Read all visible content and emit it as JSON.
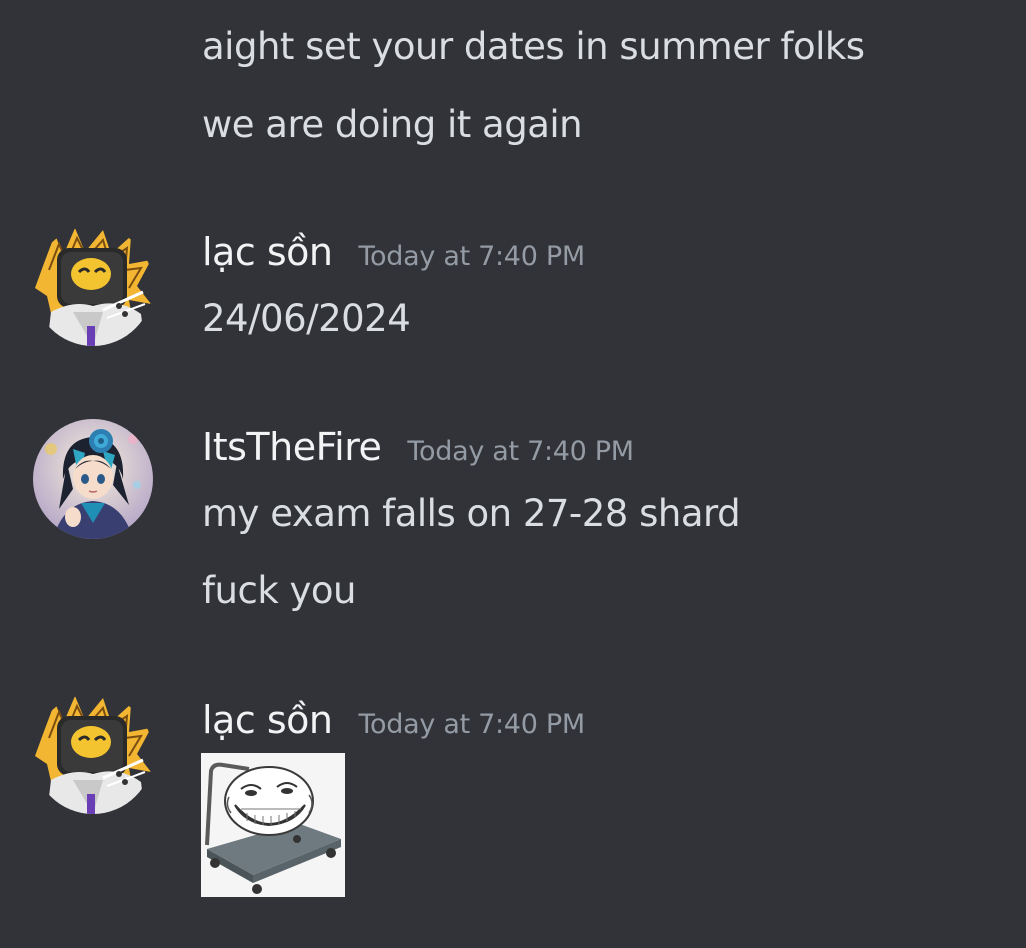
{
  "messages": {
    "continued": {
      "lines": [
        "aight set your dates in summer folks",
        "we are doing it again"
      ]
    },
    "msg1": {
      "username": "lạc sồn",
      "timestamp": "Today at 7:40 PM",
      "lines": [
        "24/06/2024"
      ],
      "avatar_icon": "robot-avatar"
    },
    "msg2": {
      "username": "ItsTheFire",
      "timestamp": "Today at 7:40 PM",
      "lines": [
        "my exam falls on 27-28 shard",
        "fuck you"
      ],
      "avatar_icon": "anime-character-avatar"
    },
    "msg3": {
      "username": "lạc sồn",
      "timestamp": "Today at 7:40 PM",
      "attachment_icon": "trollface-cart-image",
      "avatar_icon": "robot-avatar"
    }
  },
  "colors": {
    "background": "#313338",
    "text": "#dbdee1",
    "username": "#f2f3f5",
    "timestamp": "#949ba4"
  }
}
